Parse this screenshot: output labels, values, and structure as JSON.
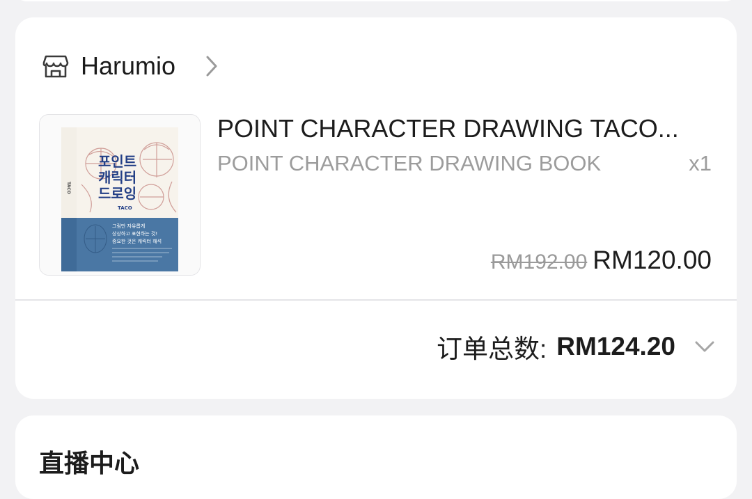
{
  "shop": {
    "name": "Harumio",
    "icon": "shop-icon",
    "chevron_icon": "chevron-right-icon"
  },
  "product": {
    "title": "POINT CHARACTER DRAWING TACO...",
    "variant": "POINT CHARACTER DRAWING BOOK",
    "quantity": "x1",
    "original_price": "RM192.00",
    "price": "RM120.00",
    "cover": {
      "title_line1": "포인트",
      "title_line2": "캐릭터",
      "title_line3": "드로잉",
      "author": "TACO",
      "spine_text": "TACO",
      "blurb_line1": "그림만 자유롭게",
      "blurb_line2": "상상하고 표현하는 것!",
      "blurb_line3": "중요한 것은 캐릭터 해석"
    }
  },
  "order_total": {
    "label": "订单总数:",
    "value": "RM124.20",
    "chevron_icon": "chevron-down-icon"
  },
  "next_section": {
    "title": "直播中心"
  },
  "colors": {
    "background": "#f2f2f4",
    "card": "#ffffff",
    "text_primary": "#1c1c1c",
    "text_secondary": "#9c9c9c",
    "divider": "#e4e4e7",
    "book_blue": "#3f6f9e"
  }
}
